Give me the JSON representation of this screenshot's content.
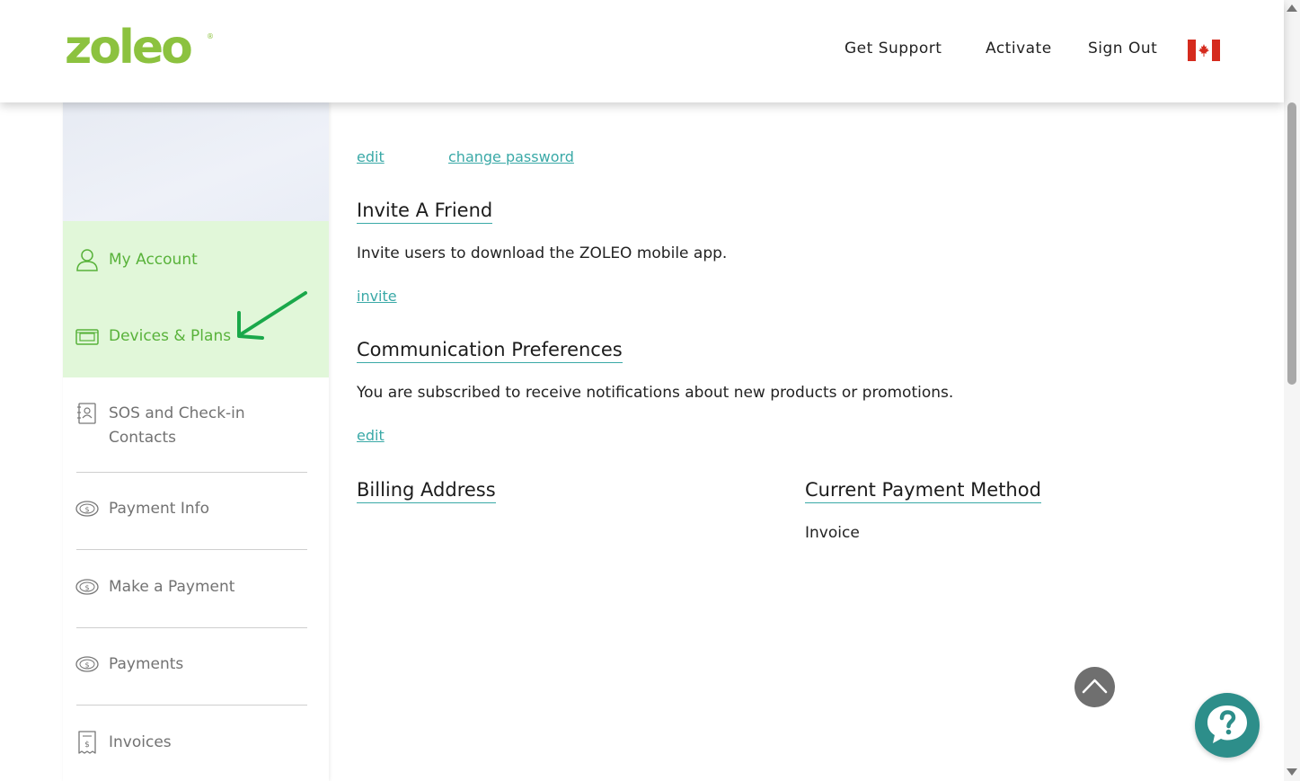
{
  "header": {
    "logo": "zoleo",
    "logo_mark": "®",
    "nav": {
      "get_support": "Get Support",
      "activate": "Activate",
      "sign_out": "Sign Out"
    },
    "flag_icon": "canada-flag-icon"
  },
  "sidebar": {
    "items": [
      {
        "label": "My Account",
        "icon": "user-icon"
      },
      {
        "label": "Devices & Plans",
        "icon": "device-icon"
      },
      {
        "label": "SOS and Check-in",
        "label_line2": "Contacts",
        "icon": "contacts-book-icon"
      },
      {
        "label": "Payment Info",
        "icon": "coin-icon"
      },
      {
        "label": "Make a Payment",
        "icon": "coin-icon"
      },
      {
        "label": "Payments",
        "icon": "coin-icon"
      },
      {
        "label": "Invoices",
        "icon": "receipt-icon"
      }
    ],
    "active_color": "#e1f7d9",
    "accent_color": "#58b23a",
    "annotation_arrow_color": "#1aa84a"
  },
  "account": {
    "edit_link": "edit",
    "change_password_link": "change password"
  },
  "invite": {
    "title": "Invite A Friend",
    "description": "Invite users to download the ZOLEO mobile app.",
    "link": "invite"
  },
  "communication": {
    "title": "Communication Preferences",
    "description": "You are subscribed to receive notifications about new products or promotions.",
    "link": "edit"
  },
  "billing": {
    "title": "Billing Address"
  },
  "payment_method": {
    "title": "Current Payment Method",
    "value": "Invoice"
  },
  "colors": {
    "link": "#3aa9a7",
    "logo": "#8cc23f",
    "help_button": "#2d8e8a",
    "flag_red": "#d52b1e"
  }
}
